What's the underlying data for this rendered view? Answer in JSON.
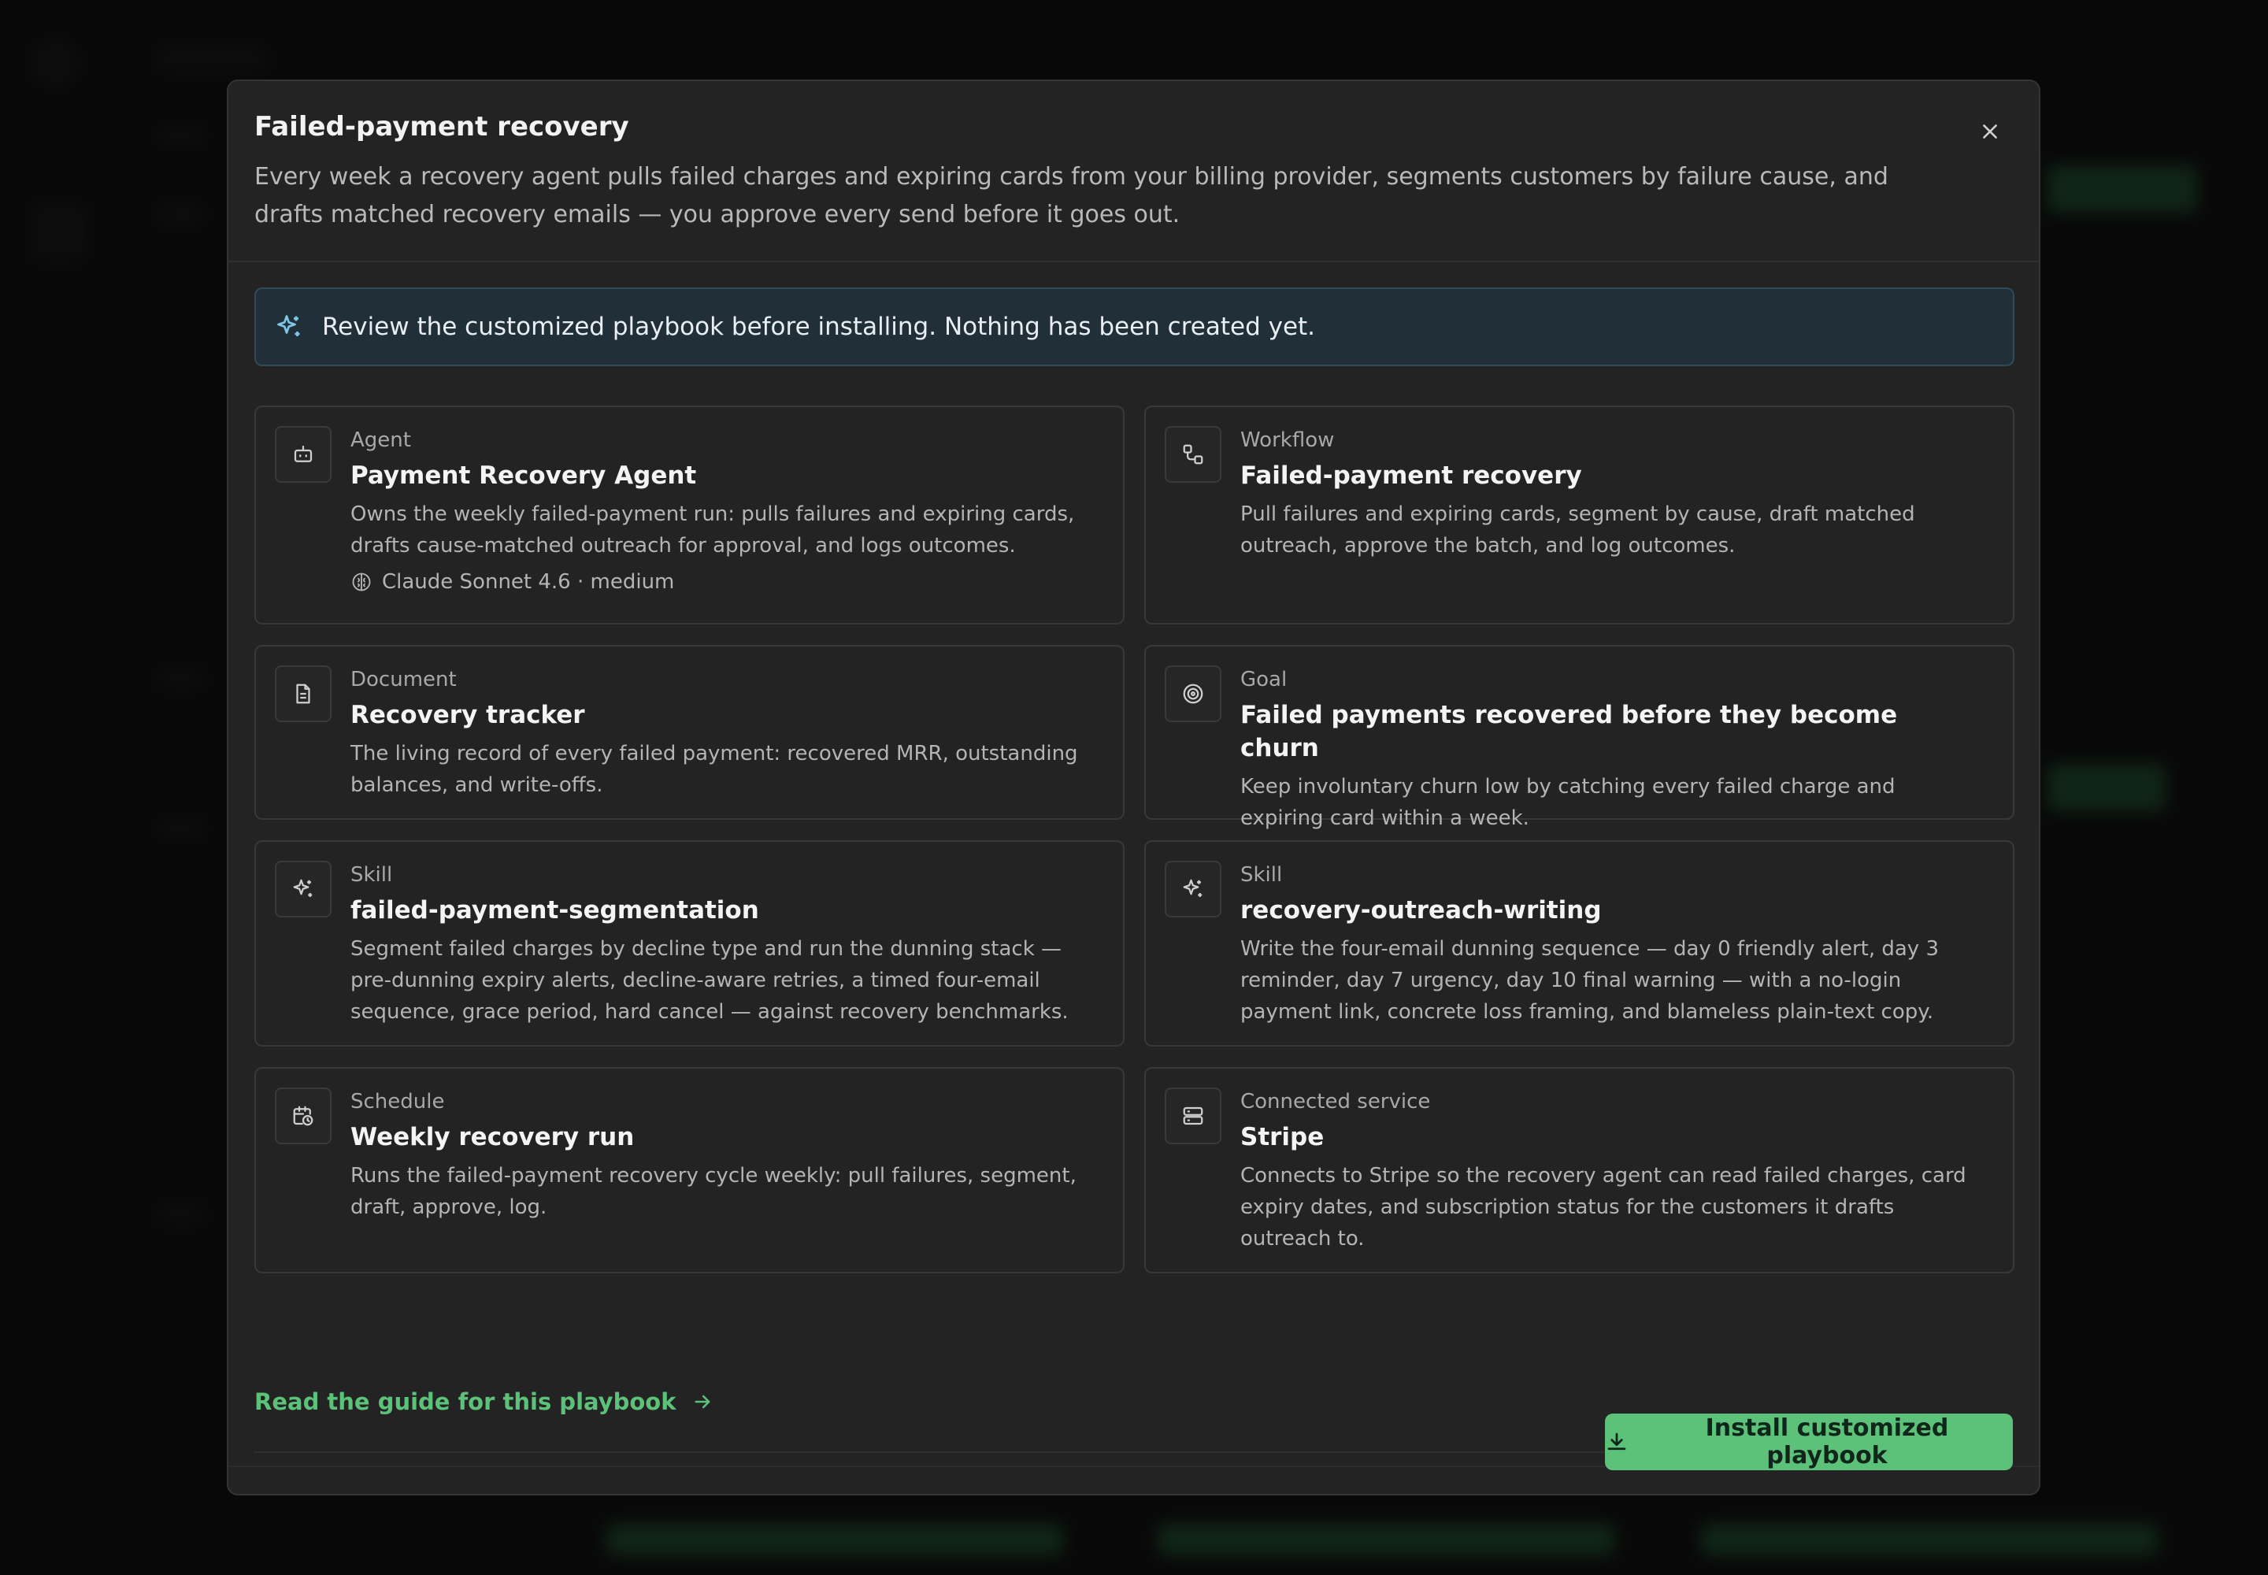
{
  "colors": {
    "accent": "#5cc27a",
    "notice_bg": "#213038",
    "modal_bg": "#232323"
  },
  "modal": {
    "title": "Failed-payment recovery",
    "description": "Every week a recovery agent pulls failed charges and expiring cards from your billing provider, segments customers by failure cause, and drafts matched recovery emails — you approve every send before it goes out.",
    "close_icon": "close-icon"
  },
  "notice": {
    "icon": "sparkle-icon",
    "text": "Review the customized playbook before installing. Nothing has been created yet."
  },
  "cards": [
    {
      "icon": "robot-icon",
      "type": "Agent",
      "name": "Payment Recovery Agent",
      "description": "Owns the weekly failed-payment run: pulls failures and expiring cards, drafts cause-matched outreach for approval, and logs outcomes.",
      "meta": "Claude Sonnet 4.6 · medium"
    },
    {
      "icon": "workflow-icon",
      "type": "Workflow",
      "name": "Failed-payment recovery",
      "description": "Pull failures and expiring cards, segment by cause, draft matched outreach, approve the batch, and log outcomes."
    },
    {
      "icon": "document-icon",
      "type": "Document",
      "name": "Recovery tracker",
      "description": "The living record of every failed payment: recovered MRR, outstanding balances, and write-offs."
    },
    {
      "icon": "target-icon",
      "type": "Goal",
      "name": "Failed payments recovered before they become churn",
      "description": "Keep involuntary churn low by catching every failed charge and expiring card within a week."
    },
    {
      "icon": "sparkle-icon",
      "type": "Skill",
      "name": "failed-payment-segmentation",
      "description": "Segment failed charges by decline type and run the dunning stack — pre-dunning expiry alerts, decline-aware retries, a timed four-email sequence, grace period, hard cancel — against recovery benchmarks."
    },
    {
      "icon": "sparkle-icon",
      "type": "Skill",
      "name": "recovery-outreach-writing",
      "description": "Write the four-email dunning sequence — day 0 friendly alert, day 3 reminder, day 7 urgency, day 10 final warning — with a no-login payment link, concrete loss framing, and blameless plain-text copy."
    },
    {
      "icon": "calendar-clock-icon",
      "type": "Schedule",
      "name": "Weekly recovery run",
      "description": "Runs the failed-payment recovery cycle weekly: pull failures, segment, draft, approve, log."
    },
    {
      "icon": "server-icon",
      "type": "Connected service",
      "name": "Stripe",
      "description": "Connects to Stripe so the recovery agent can read failed charges, card expiry dates, and subscription status for the customers it drafts outreach to."
    }
  ],
  "guide_link": {
    "label": "Read the guide for this playbook",
    "icon": "arrow-right-icon"
  },
  "install_button": {
    "label": "Install customized playbook",
    "icon": "download-icon"
  }
}
